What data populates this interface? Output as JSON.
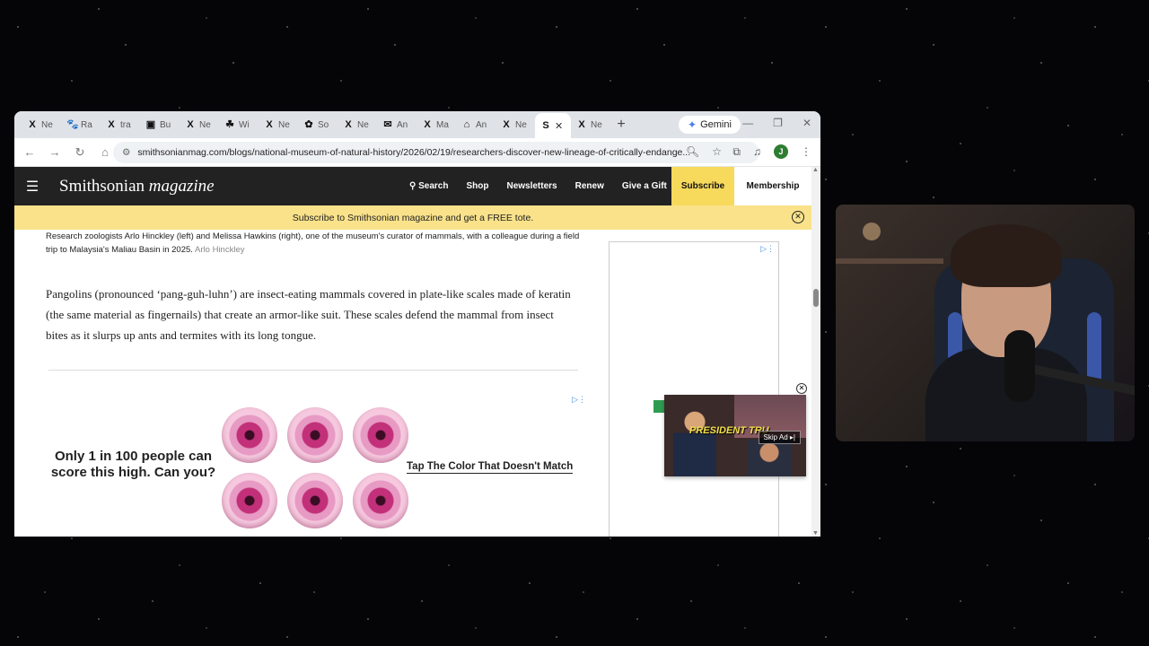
{
  "browser": {
    "tabs": [
      {
        "label": "Ne",
        "icon": "x-logo-icon",
        "glyph": "X"
      },
      {
        "label": "Ra",
        "icon": "paw-icon",
        "glyph": "🐾"
      },
      {
        "label": "tra",
        "icon": "x-logo-icon",
        "glyph": "X"
      },
      {
        "label": "Bu",
        "icon": "bookmark-app-icon",
        "glyph": "▣"
      },
      {
        "label": "Ne",
        "icon": "x-logo-icon",
        "glyph": "X"
      },
      {
        "label": "Wi",
        "icon": "wiki-icon",
        "glyph": "☘"
      },
      {
        "label": "Ne",
        "icon": "x-logo-icon",
        "glyph": "X"
      },
      {
        "label": "So",
        "icon": "source-icon",
        "glyph": "✿"
      },
      {
        "label": "Ne",
        "icon": "x-logo-icon",
        "glyph": "X"
      },
      {
        "label": "An",
        "icon": "mail-icon",
        "glyph": "✉"
      },
      {
        "label": "Ma",
        "icon": "x-logo-icon",
        "glyph": "X"
      },
      {
        "label": "An",
        "icon": "home-app-icon",
        "glyph": "⌂"
      },
      {
        "label": "Ne",
        "icon": "x-logo-icon",
        "glyph": "X"
      }
    ],
    "active_tab": {
      "icon": "smithsonian-icon",
      "glyph": "S",
      "close": "✕"
    },
    "trailing_tab": {
      "label": "Ne",
      "glyph": "X"
    },
    "new_tab": "+",
    "gemini_label": "Gemini",
    "window_controls": {
      "minimize": "—",
      "restore": "❐",
      "close": "✕"
    },
    "url": "smithsonianmag.com/blogs/national-museum-of-natural-history/2026/02/19/researchers-discover-new-lineage-of-critically-endange...",
    "profile_initial": "J"
  },
  "site": {
    "logo_main": "Smithsonian",
    "logo_italic": "magazine",
    "nav": {
      "search": "Search",
      "shop": "Shop",
      "newsletters": "Newsletters",
      "renew": "Renew",
      "give_gift": "Give a Gift",
      "subscribe": "Subscribe",
      "membership": "Membership"
    },
    "promo": "Subscribe to Smithsonian magazine and get a FREE tote."
  },
  "article": {
    "caption": "Research zoologists Arlo Hinckley (left) and Melissa Hawkins (right), one of the museum's curator of mammals, with a colleague during a field trip to Malaysia's Maliau Basin in 2025.",
    "caption_credit": "Arlo Hinckley",
    "paragraph": "Pangolins (pronounced ‘pang-guh-luhn’) are insect-eating mammals covered in plate-like scales made of keratin (the same material as fingernails) that create an armor-like suit. These scales defend the mammal from insect bites as it slurps up ants and termites with its long tongue."
  },
  "ad": {
    "headline": "Only 1 in 100 people can score this high. Can you?",
    "cta": "Tap The Color That Doesn't Match",
    "eye_count": 6
  },
  "video_ad": {
    "headline": "PRESIDENT TRU",
    "skip_label": "Skip Ad ▸|"
  }
}
